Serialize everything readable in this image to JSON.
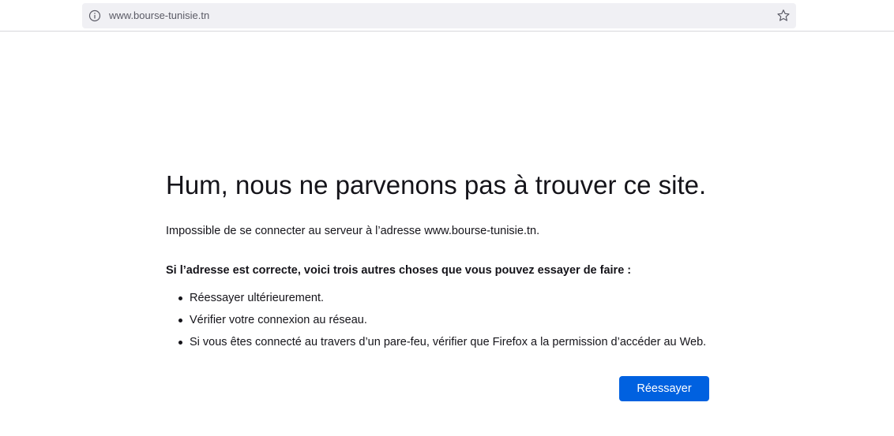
{
  "browser": {
    "url": "www.bourse-tunisie.tn",
    "icons": {
      "site_info": "info-icon",
      "bookmark": "star-icon"
    }
  },
  "error_page": {
    "title": "Hum, nous ne parvenons pas à trouver ce site.",
    "description": "Impossible de se connecter au serveur à l’adresse www.bourse-tunisie.tn.",
    "suggestions_heading": "Si l’adresse est correcte, voici trois autres choses que vous pouvez essayer de faire :",
    "suggestions": [
      "Réessayer ultérieurement.",
      "Vérifier votre connexion au réseau.",
      "Si vous êtes connecté au travers d’un pare-feu, vérifier que Firefox a la permission d’accéder au Web."
    ],
    "retry_label": "Réessayer"
  },
  "colors": {
    "accent": "#0061e0",
    "urlbar_background": "#f0f0f4",
    "text": "#15141a"
  }
}
